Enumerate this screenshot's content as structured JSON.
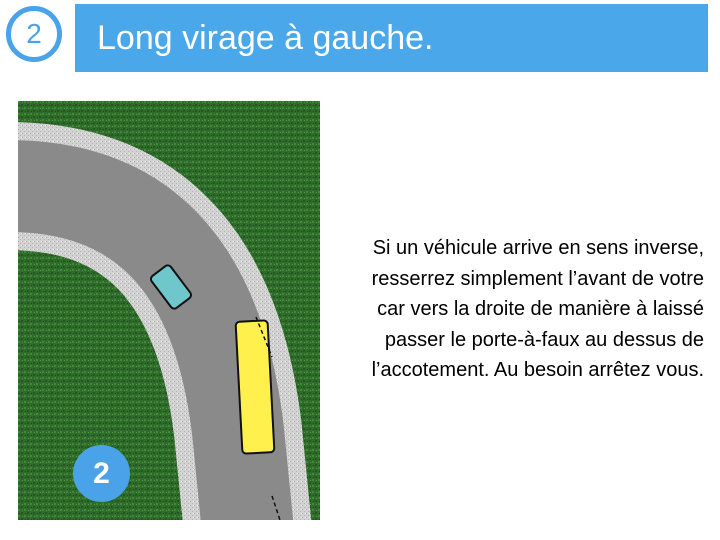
{
  "header": {
    "step_number": "2",
    "title": "Long virage à gauche."
  },
  "diagram": {
    "badge_number": "2",
    "grass_color": "#2f6b2a",
    "road_color": "#8a8a8a",
    "shoulder_color": "#c9c9c9",
    "car_color": "#6fc7cc",
    "bus_color": "#fff04d"
  },
  "description": {
    "lines": [
      "Si un véhicule arrive en sens inverse,",
      "resserrez simplement l’avant de votre",
      "car vers la droite de manière à laissé",
      "passer le porte-à-faux au dessus de",
      "l’accotement. Au besoin arrêtez vous."
    ]
  }
}
